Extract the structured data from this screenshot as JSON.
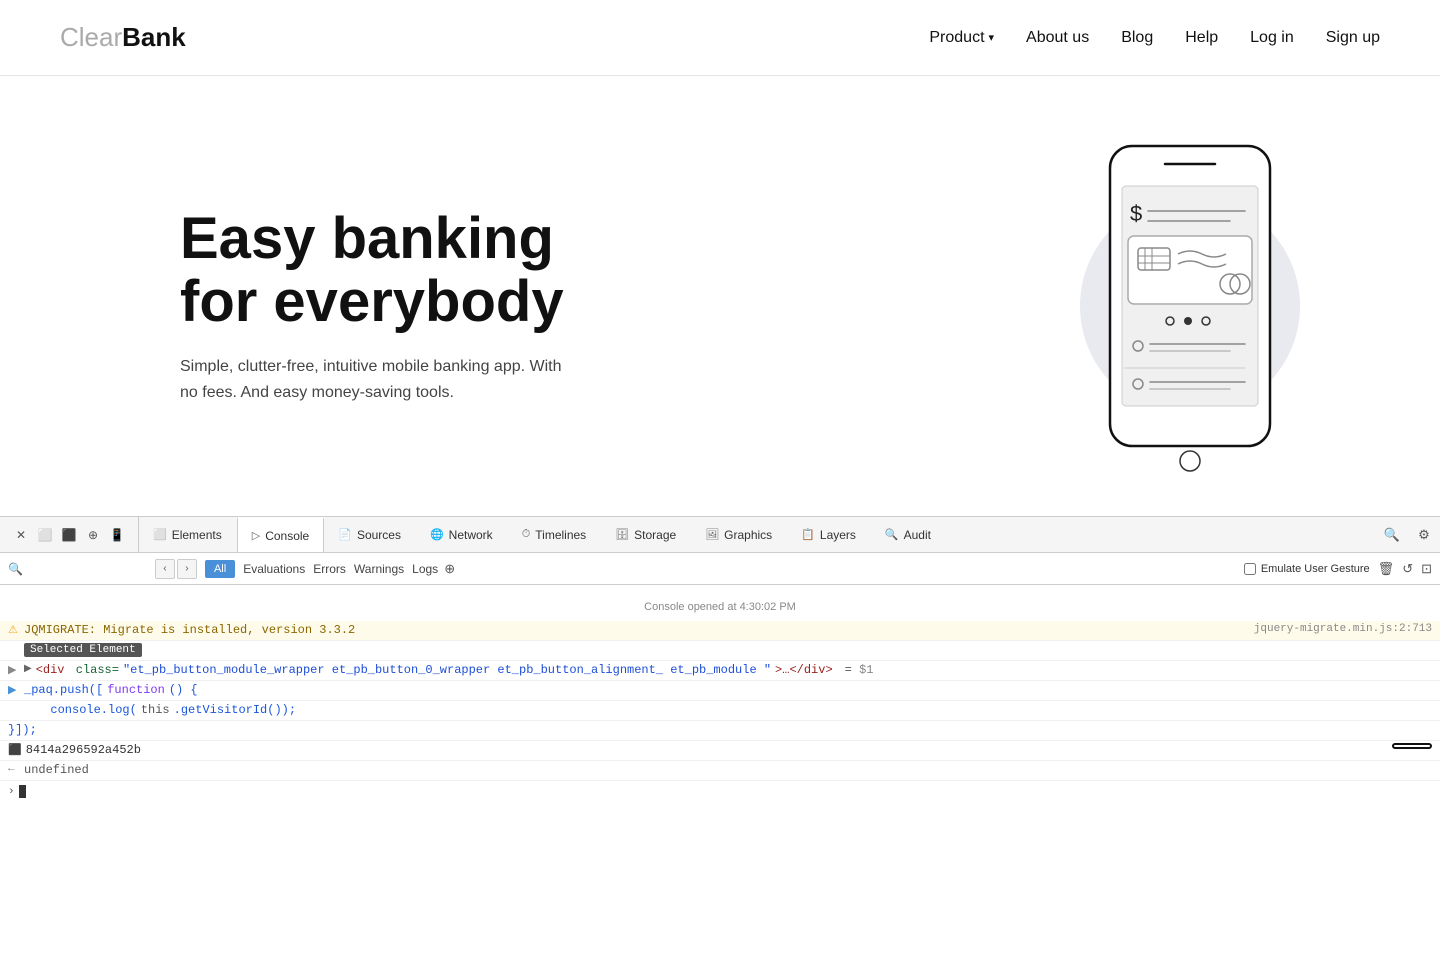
{
  "nav": {
    "logo": {
      "clear": "Clear",
      "bank": "Bank"
    },
    "links": [
      {
        "id": "product",
        "label": "Product",
        "hasDropdown": true
      },
      {
        "id": "about",
        "label": "About us"
      },
      {
        "id": "blog",
        "label": "Blog"
      },
      {
        "id": "help",
        "label": "Help"
      },
      {
        "id": "login",
        "label": "Log in"
      },
      {
        "id": "signup",
        "label": "Sign up"
      }
    ]
  },
  "hero": {
    "h1_line1": "Easy banking",
    "h1_line2": "for everybody",
    "subtitle": "Simple, clutter-free, intuitive mobile banking app. With no fees. And easy money-saving tools."
  },
  "devtools": {
    "tabs": [
      {
        "id": "elements",
        "label": "Elements",
        "icon": "⬜"
      },
      {
        "id": "console",
        "label": "Console",
        "icon": ">"
      },
      {
        "id": "sources",
        "label": "Sources",
        "icon": "📄"
      },
      {
        "id": "network",
        "label": "Network",
        "icon": "🌐"
      },
      {
        "id": "timelines",
        "label": "Timelines",
        "icon": "⏱"
      },
      {
        "id": "storage",
        "label": "Storage",
        "icon": "🗄"
      },
      {
        "id": "graphics",
        "label": "Graphics",
        "icon": "🖼"
      },
      {
        "id": "layers",
        "label": "Layers",
        "icon": "📋"
      },
      {
        "id": "audit",
        "label": "Audit",
        "icon": "🔍"
      }
    ],
    "active_tab": "console",
    "console": {
      "filter_options": [
        "All",
        "Evaluations",
        "Errors",
        "Warnings",
        "Logs"
      ],
      "active_filter": "All",
      "emulate_label": "Emulate User Gesture",
      "time_message": "Console opened at 4:30:02 PM",
      "lines": [
        {
          "type": "warn",
          "prefix": "⚠",
          "text": "JQMIGRATE: Migrate is installed, version 3.3.2",
          "source": "jquery-migrate.min.js:2:713"
        },
        {
          "type": "selected",
          "tag": "Selected Element",
          "text": ""
        },
        {
          "type": "element",
          "expand": "▶",
          "arrow": "▶",
          "elem": "<div",
          "attr1_name": " class=",
          "attr1_val": "\"et_pb_button_module_wrapper et_pb_button_0_wrapper et_pb_button_alignment_ et_pb_module \"",
          "closing": ">…</div>",
          "dollar": "= $1"
        },
        {
          "type": "code",
          "arrow": "▶",
          "text": "_paq.push([function () {"
        },
        {
          "type": "code-indent",
          "text": "console.log(this.getVisitorId());"
        },
        {
          "type": "code",
          "text": "}]);"
        },
        {
          "type": "hash",
          "prefix": "⬛",
          "text": "8414a296592a452b",
          "annotated": true
        },
        {
          "type": "undefined",
          "prefix": "←",
          "text": "undefined"
        }
      ]
    }
  }
}
